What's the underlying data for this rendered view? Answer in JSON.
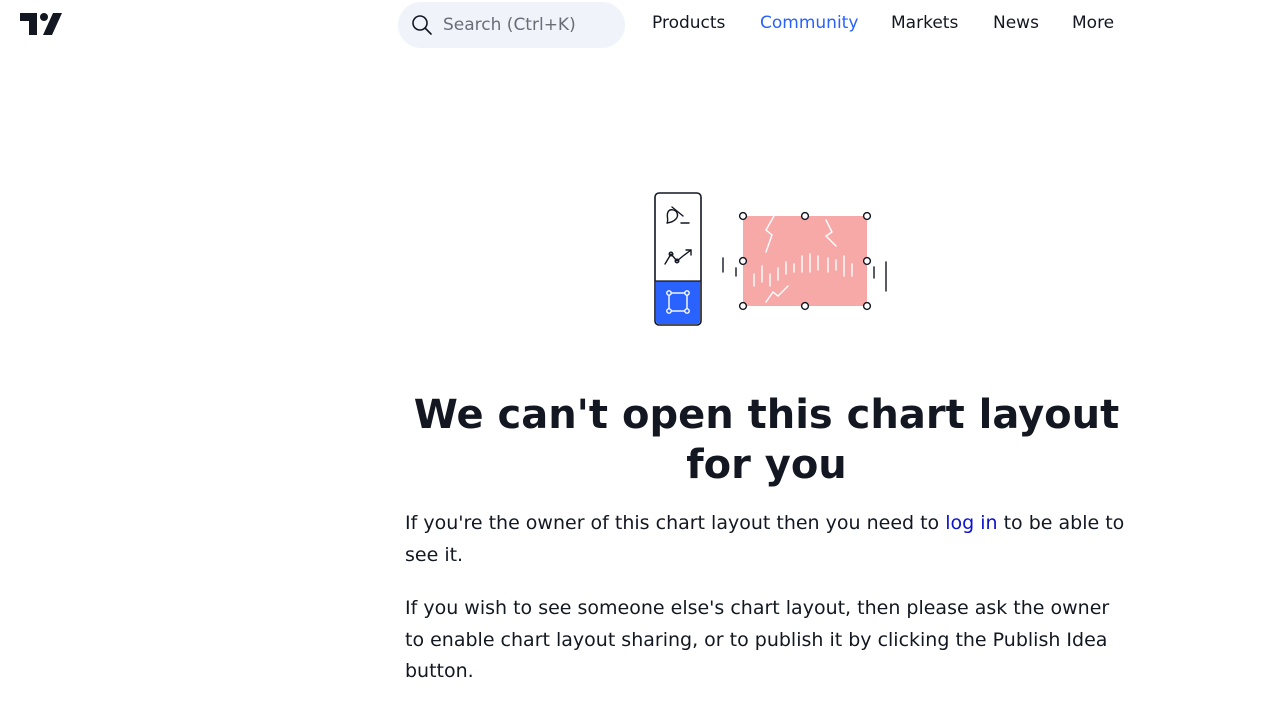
{
  "header": {
    "search_placeholder": "Search (Ctrl+K)",
    "nav": [
      "Products",
      "Community",
      "Markets",
      "News",
      "More"
    ],
    "active_nav": "Community"
  },
  "main": {
    "title": "We can't open this chart layout for you",
    "para1_before": "If you're the owner of this chart layout then you need to ",
    "para1_link": "log in",
    "para1_after": " to be able to see it.",
    "para2": "If you wish to see someone else's chart layout, then please ask the owner to enable chart layout sharing, or to publish it by clicking the Publish Idea button."
  },
  "colors": {
    "accent": "#2962ff",
    "link": "#0b11cf",
    "text": "#131722",
    "search_bg": "#f0f3fa",
    "illustration_fill": "#f7a9a8",
    "toolbar_active": "#2962ff"
  },
  "icons": [
    "tradingview-logo-icon",
    "search-icon",
    "brush-icon",
    "trend-line-icon",
    "rectangle-tool-icon"
  ]
}
